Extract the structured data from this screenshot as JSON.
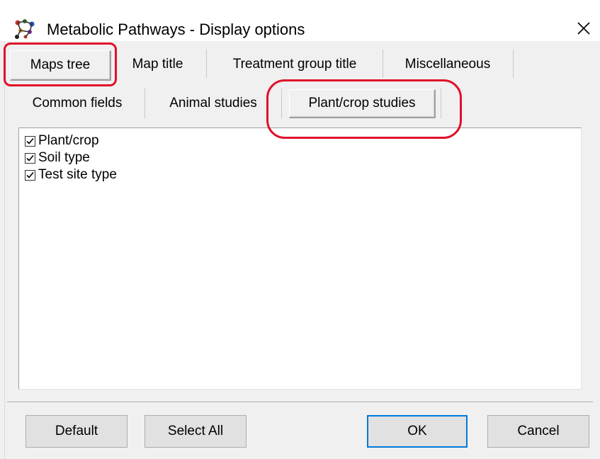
{
  "window": {
    "title": "Metabolic Pathways - Display options",
    "app_icon": "molecule-icon",
    "close_icon": "close-icon"
  },
  "tabs_row1": [
    {
      "label": "Maps tree",
      "selected": true
    },
    {
      "label": "Map title",
      "selected": false
    },
    {
      "label": "Treatment group title",
      "selected": false
    },
    {
      "label": "Miscellaneous",
      "selected": false
    }
  ],
  "tabs_row2": [
    {
      "label": "Common fields",
      "selected": false
    },
    {
      "label": "Animal studies",
      "selected": false
    },
    {
      "label": "Plant/crop studies",
      "selected": true
    }
  ],
  "fields": [
    {
      "label": "Plant/crop",
      "checked": true
    },
    {
      "label": "Soil type",
      "checked": true
    },
    {
      "label": "Test site type",
      "checked": true
    }
  ],
  "buttons": {
    "default": "Default",
    "select_all": "Select All",
    "ok": "OK",
    "cancel": "Cancel"
  },
  "colors": {
    "highlight": "#e0102a",
    "focus_border": "#0078d7"
  }
}
